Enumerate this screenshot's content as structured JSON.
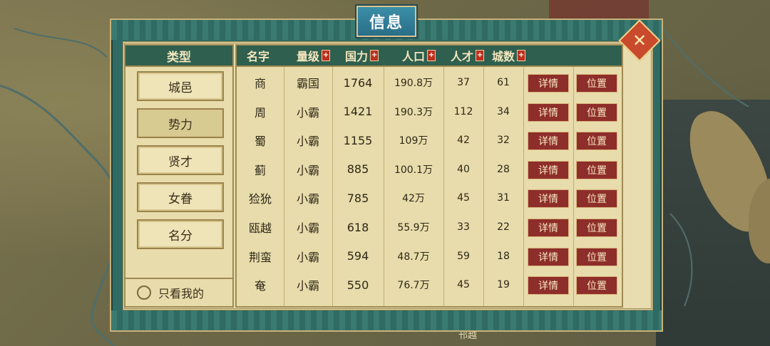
{
  "window": {
    "title": "信息"
  },
  "close_icon": "✕",
  "map": {
    "label": "邗越"
  },
  "sidebar": {
    "header": "类型",
    "items": [
      {
        "label": "城邑",
        "active": false
      },
      {
        "label": "势力",
        "active": true
      },
      {
        "label": "贤才",
        "active": false
      },
      {
        "label": "女眷",
        "active": false
      },
      {
        "label": "名分",
        "active": false
      }
    ],
    "only_mine_label": "只看我的"
  },
  "table": {
    "columns": [
      "名字",
      "量级",
      "国力",
      "人口",
      "人才",
      "城数"
    ],
    "sort_symbol": "+",
    "detail_label": "详情",
    "location_label": "位置",
    "rows": [
      {
        "name": "商",
        "rank": "霸国",
        "power": "1764",
        "pop": "190.8万",
        "talent": "37",
        "cities": "61"
      },
      {
        "name": "周",
        "rank": "小霸",
        "power": "1421",
        "pop": "190.3万",
        "talent": "112",
        "cities": "34"
      },
      {
        "name": "蜀",
        "rank": "小霸",
        "power": "1155",
        "pop": "109万",
        "talent": "42",
        "cities": "32"
      },
      {
        "name": "蓟",
        "rank": "小霸",
        "power": "885",
        "pop": "100.1万",
        "talent": "40",
        "cities": "28"
      },
      {
        "name": "猃狁",
        "rank": "小霸",
        "power": "785",
        "pop": "42万",
        "talent": "45",
        "cities": "31"
      },
      {
        "name": "瓯越",
        "rank": "小霸",
        "power": "618",
        "pop": "55.9万",
        "talent": "33",
        "cities": "22"
      },
      {
        "name": "荆蛮",
        "rank": "小霸",
        "power": "594",
        "pop": "48.7万",
        "talent": "59",
        "cities": "18"
      },
      {
        "name": "奄",
        "rank": "小霸",
        "power": "550",
        "pop": "76.7万",
        "talent": "45",
        "cities": "19"
      }
    ]
  },
  "colors": {
    "panel": "#2f6a63",
    "header": "#2f5f4e",
    "button": "#8e2e2a",
    "paper": "#e8dcac"
  }
}
